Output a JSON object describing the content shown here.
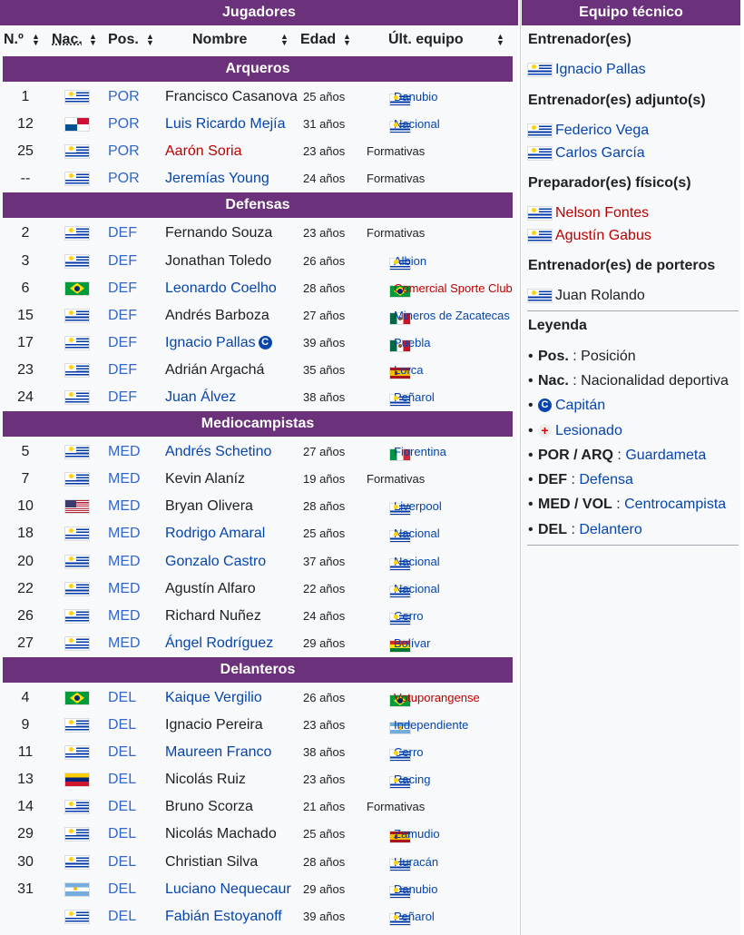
{
  "roster": {
    "title": "Jugadores",
    "columns": [
      "N.º",
      "Nac.",
      "Pos.",
      "Nombre",
      "Edad",
      "Últ. equipo"
    ],
    "sections": [
      {
        "label": "Arqueros",
        "players": [
          {
            "num": "1",
            "nat": "uy",
            "pos": "POR",
            "name": "Francisco Casanova",
            "link": "plain",
            "age": "25 años",
            "flag": "uy",
            "team": "Danubio",
            "tlink": "blue"
          },
          {
            "num": "12",
            "nat": "pa",
            "pos": "POR",
            "name": "Luis Ricardo Mejía",
            "link": "blue",
            "age": "31 años",
            "flag": "uy",
            "team": "Nacional",
            "tlink": "blue"
          },
          {
            "num": "25",
            "nat": "uy",
            "pos": "POR",
            "name": "Aarón Soria",
            "link": "red",
            "age": "23 años",
            "flag": "",
            "team": "Formativas",
            "tlink": "plain"
          },
          {
            "num": "--",
            "nat": "uy",
            "pos": "POR",
            "name": "Jeremías Young",
            "link": "blue",
            "age": "24 años",
            "flag": "",
            "team": "Formativas",
            "tlink": "plain"
          }
        ]
      },
      {
        "label": "Defensas",
        "players": [
          {
            "num": "2",
            "nat": "uy",
            "pos": "DEF",
            "name": "Fernando Souza",
            "link": "plain",
            "age": "23 años",
            "flag": "",
            "team": "Formativas",
            "tlink": "plain"
          },
          {
            "num": "3",
            "nat": "uy",
            "pos": "DEF",
            "name": "Jonathan Toledo",
            "link": "plain",
            "age": "26 años",
            "flag": "uy",
            "team": "Albion",
            "tlink": "blue"
          },
          {
            "num": "6",
            "nat": "br",
            "pos": "DEF",
            "name": "Leonardo Coelho",
            "link": "blue",
            "age": "28 años",
            "flag": "br",
            "team": "Comercial Sporte Club",
            "tlink": "red"
          },
          {
            "num": "15",
            "nat": "uy",
            "pos": "DEF",
            "name": "Andrés Barboza",
            "link": "plain",
            "age": "27 años",
            "flag": "mx",
            "team": "Mineros de Zacatecas",
            "tlink": "blue"
          },
          {
            "num": "17",
            "nat": "uy",
            "pos": "DEF",
            "name": "Ignacio Pallas",
            "link": "blue",
            "cap": true,
            "age": "39 años",
            "flag": "mx",
            "team": "Puebla",
            "tlink": "blue"
          },
          {
            "num": "23",
            "nat": "uy",
            "pos": "DEF",
            "name": "Adrián Argachá",
            "link": "plain",
            "age": "35 años",
            "flag": "es",
            "team": "Lorca",
            "tlink": "blue"
          },
          {
            "num": "24",
            "nat": "uy",
            "pos": "DEF",
            "name": "Juan Álvez",
            "link": "blue",
            "age": "38 años",
            "flag": "uy",
            "team": "Peñarol",
            "tlink": "blue"
          }
        ]
      },
      {
        "label": "Mediocampistas",
        "players": [
          {
            "num": "5",
            "nat": "uy",
            "pos": "MED",
            "name": "Andrés Schetino",
            "link": "blue",
            "age": "27 años",
            "flag": "it",
            "team": "Fiorentina",
            "tlink": "blue"
          },
          {
            "num": "7",
            "nat": "uy",
            "pos": "MED",
            "name": "Kevin Alaníz",
            "link": "plain",
            "age": "19 años",
            "flag": "",
            "team": "Formativas",
            "tlink": "plain"
          },
          {
            "num": "10",
            "nat": "us",
            "pos": "MED",
            "name": "Bryan Olivera",
            "link": "plain",
            "age": "28 años",
            "flag": "uy",
            "team": "Liverpool",
            "tlink": "blue"
          },
          {
            "num": "18",
            "nat": "uy",
            "pos": "MED",
            "name": "Rodrigo Amaral",
            "link": "blue",
            "age": "25 años",
            "flag": "uy",
            "team": "Nacional",
            "tlink": "blue"
          },
          {
            "num": "20",
            "nat": "uy",
            "pos": "MED",
            "name": "Gonzalo Castro",
            "link": "blue",
            "age": "37 años",
            "flag": "uy",
            "team": "Nacional",
            "tlink": "blue"
          },
          {
            "num": "22",
            "nat": "uy",
            "pos": "MED",
            "name": "Agustín Alfaro",
            "link": "plain",
            "age": "22 años",
            "flag": "uy",
            "team": "Nacional",
            "tlink": "blue"
          },
          {
            "num": "26",
            "nat": "uy",
            "pos": "MED",
            "name": "Richard Nuñez",
            "link": "plain",
            "age": "24 años",
            "flag": "uy",
            "team": "Cerro",
            "tlink": "blue"
          },
          {
            "num": "27",
            "nat": "uy",
            "pos": "MED",
            "name": "Ángel Rodríguez",
            "link": "blue",
            "age": "29 años",
            "flag": "bo",
            "team": "Bolívar",
            "tlink": "blue"
          }
        ]
      },
      {
        "label": "Delanteros",
        "players": [
          {
            "num": "4",
            "nat": "br",
            "pos": "DEL",
            "name": "Kaique Vergilio",
            "link": "blue",
            "age": "26 años",
            "flag": "br",
            "team": "Votuporangense",
            "tlink": "red"
          },
          {
            "num": "9",
            "nat": "uy",
            "pos": "DEL",
            "name": "Ignacio Pereira",
            "link": "plain",
            "age": "23 años",
            "flag": "ar",
            "team": "Independiente",
            "tlink": "blue"
          },
          {
            "num": "11",
            "nat": "uy",
            "pos": "DEL",
            "name": "Maureen Franco",
            "link": "blue",
            "age": "38 años",
            "flag": "uy",
            "team": "Cerro",
            "tlink": "blue"
          },
          {
            "num": "13",
            "nat": "ve",
            "pos": "DEL",
            "name": "Nicolás Ruiz",
            "link": "plain",
            "age": "23 años",
            "flag": "uy",
            "team": "Racing",
            "tlink": "blue"
          },
          {
            "num": "14",
            "nat": "uy",
            "pos": "DEL",
            "name": "Bruno Scorza",
            "link": "plain",
            "age": "21 años",
            "flag": "",
            "team": "Formativas",
            "tlink": "plain"
          },
          {
            "num": "29",
            "nat": "uy",
            "pos": "DEL",
            "name": "Nicolás Machado",
            "link": "plain",
            "age": "25 años",
            "flag": "es",
            "team": "Zamudio",
            "tlink": "blue"
          },
          {
            "num": "30",
            "nat": "uy",
            "pos": "DEL",
            "name": "Christian Silva",
            "link": "plain",
            "age": "28 años",
            "flag": "uy",
            "team": "Huracán",
            "tlink": "blue"
          },
          {
            "num": "31",
            "nat": "ar",
            "pos": "DEL",
            "name": "Luciano Nequecaur",
            "link": "blue",
            "age": "29 años",
            "flag": "uy",
            "team": "Danubio",
            "tlink": "blue"
          },
          {
            "num": "",
            "nat": "uy",
            "pos": "DEL",
            "name": "Fabián Estoyanoff",
            "link": "blue",
            "age": "39 años",
            "flag": "uy",
            "team": "Peñarol",
            "tlink": "blue"
          }
        ]
      }
    ]
  },
  "staff": {
    "title": "Equipo técnico",
    "groups": [
      {
        "label": "Entrenador(es)",
        "members": [
          {
            "name": "Ignacio Pallas",
            "link": "blue"
          }
        ]
      },
      {
        "label": "Entrenador(es) adjunto(s)",
        "members": [
          {
            "name": "Federico Vega",
            "link": "blue"
          },
          {
            "name": "Carlos García",
            "link": "blue"
          }
        ]
      },
      {
        "label": "Preparador(es) físico(s)",
        "members": [
          {
            "name": "Nelson Fontes",
            "link": "red"
          },
          {
            "name": "Agustín Gabus",
            "link": "red"
          }
        ]
      },
      {
        "label": "Entrenador(es) de porteros",
        "members": [
          {
            "name": "Juan Rolando",
            "link": "plain"
          }
        ]
      }
    ],
    "legend_title": "Leyenda",
    "legend": {
      "pos_key": "Pos.",
      "pos_val": "Posición",
      "nac_key": "Nac.",
      "nac_val": "Nacionalidad deportiva",
      "cap_mark": "C",
      "cap_label": "Capitán",
      "inj_mark": "+",
      "inj_label": "Lesionado",
      "por_key": "POR / ARQ",
      "por_val": "Guardameta",
      "def_key": "DEF",
      "def_val": "Defensa",
      "med_key": "MED / VOL",
      "med_val": "Centrocampista",
      "del_key": "DEL",
      "del_val": "Delantero",
      "sep": " : "
    }
  },
  "colors": {
    "header_bg": "#6b317a",
    "link_blue": "#0645ad",
    "link_red": "#ba0000",
    "pos_blue": "#3366cc"
  }
}
